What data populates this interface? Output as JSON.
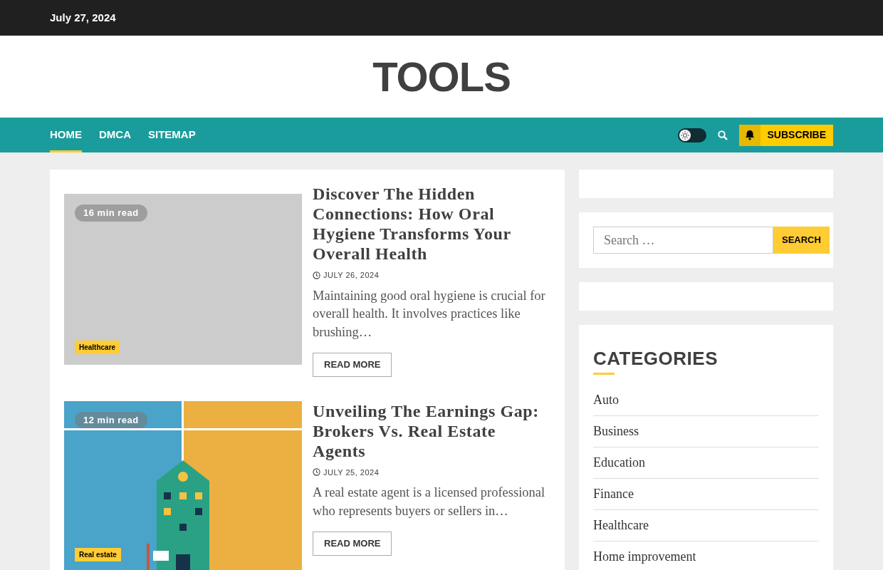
{
  "top_bar": {
    "date": "July 27, 2024"
  },
  "site": {
    "title": "TOOLS"
  },
  "nav": {
    "items": [
      {
        "label": "HOME",
        "selected": true
      },
      {
        "label": "DMCA",
        "selected": false
      },
      {
        "label": "SITEMAP",
        "selected": false
      }
    ],
    "theme_toggle": {
      "on": false
    },
    "subscribe": "SUBSCRIBE"
  },
  "posts": [
    {
      "read_time": "16 min read",
      "category": "Healthcare",
      "image": {
        "kind": "blank"
      },
      "title": "Discover The Hidden Connections: How Oral Hygiene Transforms Your Overall Health",
      "date": "JULY 26, 2024",
      "excerpt": "Maintaining good oral hygiene is crucial for overall health. It involves practices like brushing…",
      "button": "READ MORE"
    },
    {
      "read_time": "12 min read",
      "category": "Real estate",
      "title": "Unveiling The Earnings Gap: Brokers Vs. Real Estate Agents",
      "date": "JULY 25, 2024",
      "excerpt": "A real estate agent is a licensed professional who represents buyers or sellers in…",
      "button": "READ MORE"
    }
  ],
  "sidebar": {
    "search": {
      "placeholder": "Search …",
      "button": "SEARCH"
    },
    "categories": {
      "title": "CATEGORIES",
      "items": [
        "Auto",
        "Business",
        "Education",
        "Finance",
        "Healthcare",
        "Home improvement"
      ]
    }
  }
}
